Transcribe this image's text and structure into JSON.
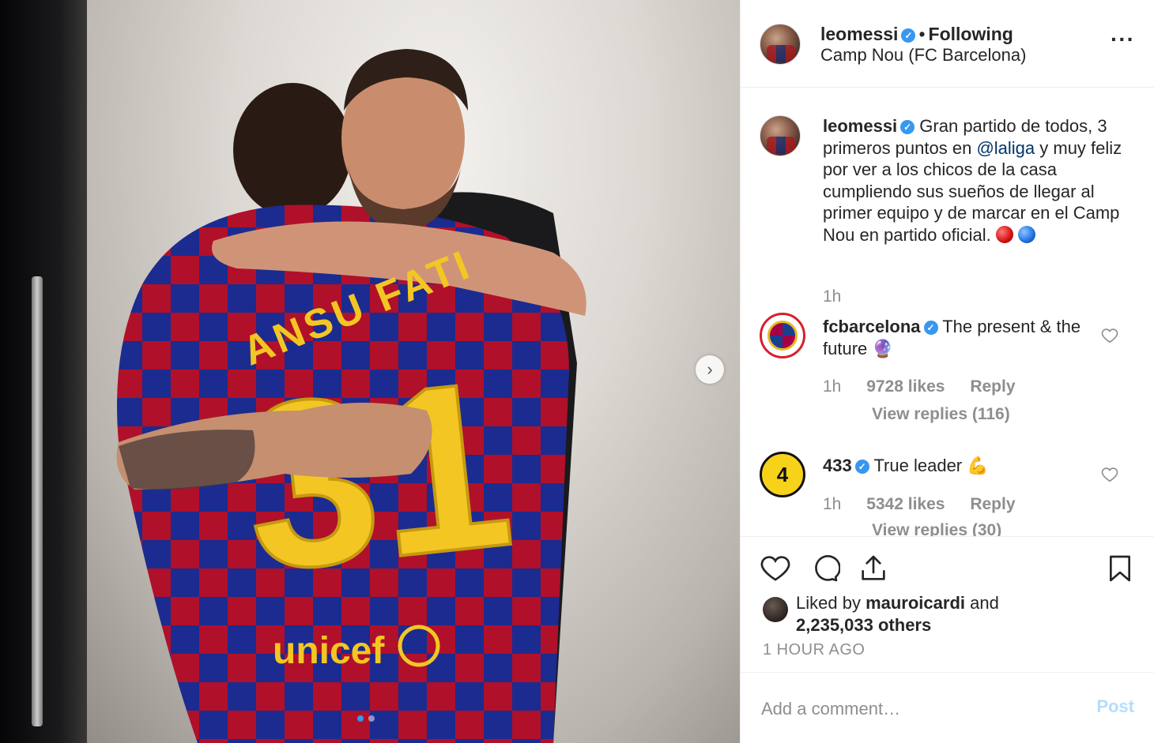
{
  "post": {
    "username": "leomessi",
    "following_label": "Following",
    "location": "Camp Nou (FC Barcelona)",
    "more_icon": "more-horizontal-icon"
  },
  "photo": {
    "jersey_name": "ANSU FATI",
    "jersey_number": "31",
    "sponsor": "unicef",
    "carousel_dots": 2,
    "active_dot": 0
  },
  "caption": {
    "username": "leomessi",
    "text_before_mention": "Gran partido de todos, 3 primeros puntos en ",
    "mention": "@laliga",
    "text_after_mention": " y muy feliz por ver a los chicos de la casa cumpliendo sus sueños de llegar al primer equipo y de marcar en el Camp Nou en partido oficial.",
    "time": "1h"
  },
  "comments": [
    {
      "username": "fcbarcelona",
      "text": "The present & the future",
      "emoji": "🔮",
      "time": "1h",
      "likes": "9728 likes",
      "reply_label": "Reply",
      "view_replies": "View replies (116)"
    },
    {
      "username": "433",
      "text": "True leader",
      "emoji": "💪",
      "time": "1h",
      "likes": "5342 likes",
      "reply_label": "Reply",
      "view_replies": "View replies (30)"
    }
  ],
  "liked_by": {
    "prefix": "Liked by ",
    "user": "mauroicardi",
    "and": " and",
    "others": "2,235,033 others"
  },
  "time_ago": "1 HOUR AGO",
  "comment_box": {
    "placeholder": "Add a comment…",
    "post_label": "Post"
  },
  "colors": {
    "accent_blue": "#3897f0",
    "muted_text": "#8e8e8e",
    "mention": "#003569",
    "post_disabled": "#b2dffc"
  }
}
